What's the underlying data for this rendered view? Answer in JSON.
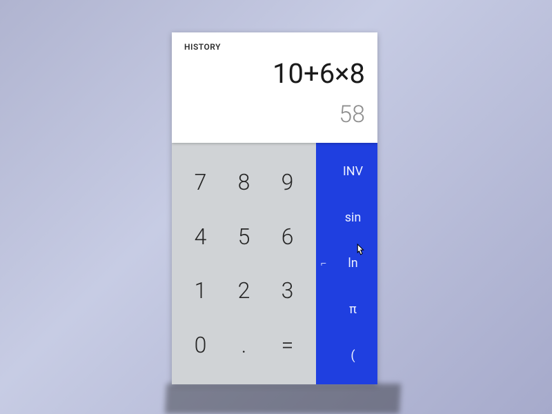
{
  "display": {
    "history_label": "HISTORY",
    "expression": "10+6×8",
    "result": "58"
  },
  "numpad": [
    [
      "7",
      "8",
      "9"
    ],
    [
      "4",
      "5",
      "6"
    ],
    [
      "1",
      "2",
      "3"
    ],
    [
      "0",
      ".",
      "="
    ]
  ],
  "sci_panel": {
    "rows": [
      {
        "left": "",
        "right": "INV"
      },
      {
        "left": "",
        "right": "sin"
      },
      {
        "left": "⌐",
        "right": "ln"
      },
      {
        "left": "",
        "right": "π"
      },
      {
        "left": "",
        "right": "("
      }
    ]
  },
  "colors": {
    "sci_bg": "#1f3fe0",
    "numpad_bg": "#d0d3d6",
    "display_bg": "#ffffff"
  }
}
